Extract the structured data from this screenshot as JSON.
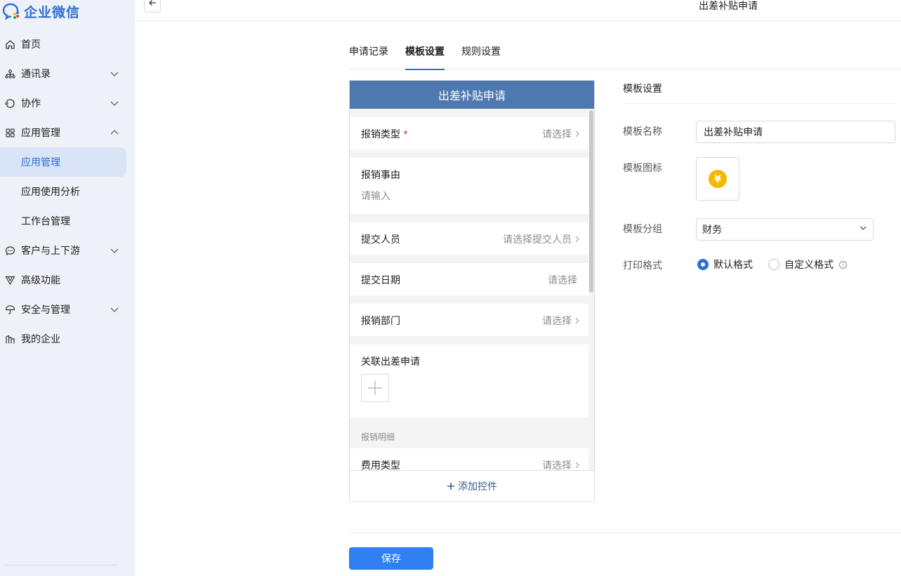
{
  "app": {
    "name": "企业微信"
  },
  "sidebar": {
    "items": [
      {
        "label": "首页",
        "icon": "home-icon"
      },
      {
        "label": "通讯录",
        "icon": "org-icon",
        "expandable": true
      },
      {
        "label": "协作",
        "icon": "collab-icon",
        "expandable": true
      },
      {
        "label": "应用管理",
        "icon": "apps-icon",
        "expandable": true,
        "expanded": true
      },
      {
        "label": "客户与上下游",
        "icon": "chat-icon",
        "expandable": true
      },
      {
        "label": "高级功能",
        "icon": "advanced-icon"
      },
      {
        "label": "安全与管理",
        "icon": "umbrella-icon",
        "expandable": true
      },
      {
        "label": "我的企业",
        "icon": "building-icon"
      }
    ],
    "subitems": [
      {
        "label": "应用管理",
        "active": true
      },
      {
        "label": "应用使用分析"
      },
      {
        "label": "工作台管理"
      }
    ]
  },
  "header": {
    "title": "出差补贴申请"
  },
  "tabs": [
    {
      "label": "申请记录"
    },
    {
      "label": "模板设置",
      "active": true
    },
    {
      "label": "规则设置"
    }
  ],
  "preview": {
    "title": "出差补贴申请",
    "fields": [
      {
        "label": "报销类型",
        "value": "请选择"
      },
      {
        "label": "报销事由",
        "placeholder": "请输入"
      },
      {
        "label": "提交人员",
        "value": "请选择提交人员"
      },
      {
        "label": "提交日期",
        "value": "请选择"
      },
      {
        "label": "报销部门",
        "value": "请选择"
      },
      {
        "label": "关联出差申请"
      },
      {
        "label": "费用类型",
        "value": "请选择"
      }
    ],
    "required_mark": "*",
    "group_label": "报销明细",
    "add_control": "添加控件"
  },
  "settings": {
    "title": "模板设置",
    "name_label": "模板名称",
    "name_value": "出差补贴申请",
    "icon_label": "模板图标",
    "icon_glyph": "¥",
    "icon_color": "#f5b800",
    "group_label": "模板分组",
    "group_value": "财务",
    "print_label": "打印格式",
    "print_options": [
      {
        "label": "默认格式",
        "checked": true
      },
      {
        "label": "自定义格式"
      }
    ]
  },
  "actions": {
    "save": "保存"
  },
  "colors": {
    "accent": "#2f6fd1",
    "preview_header": "#4e79b0",
    "sidebar_bg": "#eef1f8"
  }
}
